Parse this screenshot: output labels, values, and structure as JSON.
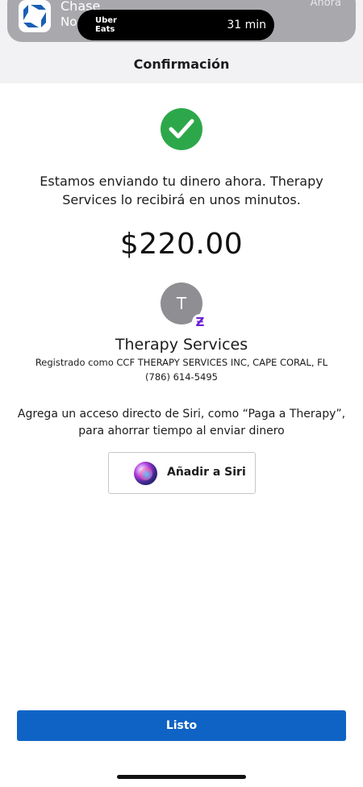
{
  "notification": {
    "app_name": "Chase",
    "subtitle": "No",
    "time": "Ahora",
    "icon": "chase-octagon-logo"
  },
  "live_activity": {
    "app_logo_line1": "Uber",
    "app_logo_line2": "Eats",
    "eta": "31 min"
  },
  "header": {
    "title": "Confirmación"
  },
  "confirmation": {
    "status_icon": "checkmark-icon",
    "status_color": "#2ca84a",
    "message": "Estamos enviando tu dinero ahora. Therapy Services lo recibirá en unos minutos.",
    "amount": "$220.00"
  },
  "recipient": {
    "initial": "T",
    "badge": "Ƶ",
    "name": "Therapy Services",
    "registered_as": "Registrado como CCF THERAPY SERVICES INC, CAPE CORAL, FL",
    "phone": "(786) 614-5495"
  },
  "siri": {
    "prompt": "Agrega un acceso directo de Siri, como “Paga a Therapy”, para ahorrar tiempo al enviar dinero",
    "button_label": "Añadir a Siri"
  },
  "footer": {
    "done_label": "Listo",
    "accent_color": "#0f63c5"
  }
}
